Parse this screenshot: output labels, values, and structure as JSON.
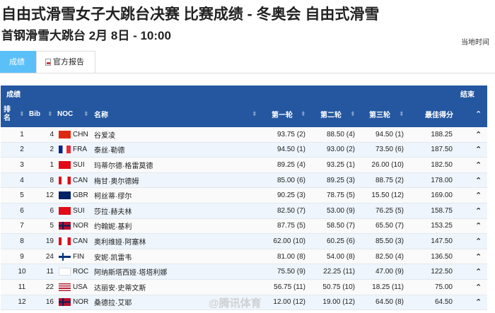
{
  "header": {
    "title": "自由式滑雪女子大跳台决赛 比赛成绩 - 冬奥会 自由式滑雪",
    "subtitle": "首钢滑雪大跳台 2月 8日 - 10:00",
    "local_time": "当地时间"
  },
  "tabs": [
    {
      "label": "成绩"
    },
    {
      "label": "官方报告"
    }
  ],
  "table": {
    "section": "成绩",
    "status": "结束",
    "columns": {
      "rank": "排名",
      "bib": "Bib",
      "noc": "NOC",
      "name": "名称",
      "r1": "第一轮",
      "r2": "第二轮",
      "r3": "第三轮",
      "best": "最佳得分"
    },
    "rows": [
      {
        "rank": "1",
        "bib": "4",
        "noc": "CHN",
        "name": "谷爱凌",
        "r1": "93.75 (2)",
        "r2": "88.50 (4)",
        "r3": "94.50 (1)",
        "best": "188.25"
      },
      {
        "rank": "2",
        "bib": "2",
        "noc": "FRA",
        "name": "泰丝·勒德",
        "r1": "94.50 (1)",
        "r2": "93.00 (2)",
        "r3": "73.50 (6)",
        "best": "187.50"
      },
      {
        "rank": "3",
        "bib": "1",
        "noc": "SUI",
        "name": "玛蒂尔德·格雷莫德",
        "r1": "89.25 (4)",
        "r2": "93.25 (1)",
        "r3": "26.00 (10)",
        "best": "182.50"
      },
      {
        "rank": "4",
        "bib": "8",
        "noc": "CAN",
        "name": "梅甘·奥尔德姆",
        "r1": "85.00 (6)",
        "r2": "89.25 (3)",
        "r3": "88.75 (2)",
        "best": "178.00"
      },
      {
        "rank": "5",
        "bib": "12",
        "noc": "GBR",
        "name": "柯丝蒂·缪尔",
        "r1": "90.25 (3)",
        "r2": "78.75 (5)",
        "r3": "15.50 (12)",
        "best": "169.00"
      },
      {
        "rank": "6",
        "bib": "6",
        "noc": "SUI",
        "name": "莎拉·赫夫林",
        "r1": "82.50 (7)",
        "r2": "53.00 (9)",
        "r3": "76.25 (5)",
        "best": "158.75"
      },
      {
        "rank": "7",
        "bib": "5",
        "noc": "NOR",
        "name": "约翰妮·基利",
        "r1": "87.75 (5)",
        "r2": "58.50 (7)",
        "r3": "65.50 (7)",
        "best": "153.25"
      },
      {
        "rank": "8",
        "bib": "19",
        "noc": "CAN",
        "name": "奥利维娅·阿塞林",
        "r1": "62.00 (10)",
        "r2": "60.25 (6)",
        "r3": "85.50 (3)",
        "best": "147.50"
      },
      {
        "rank": "9",
        "bib": "24",
        "noc": "FIN",
        "name": "安妮·凯雷韦",
        "r1": "81.00 (8)",
        "r2": "54.00 (8)",
        "r3": "82.50 (4)",
        "best": "136.50"
      },
      {
        "rank": "10",
        "bib": "11",
        "noc": "ROC",
        "name": "阿纳斯塔西娅·塔塔利娜",
        "r1": "75.50 (9)",
        "r2": "22.25 (11)",
        "r3": "47.00 (9)",
        "best": "122.50"
      },
      {
        "rank": "11",
        "bib": "22",
        "noc": "USA",
        "name": "达丽安·史蒂文斯",
        "r1": "56.75 (11)",
        "r2": "50.75 (10)",
        "r3": "18.25 (11)",
        "best": "75.00"
      },
      {
        "rank": "12",
        "bib": "16",
        "noc": "NOR",
        "name": "桑德拉·艾耶",
        "r1": "12.00 (12)",
        "r2": "19.00 (12)",
        "r3": "64.50 (8)",
        "best": "64.50"
      }
    ]
  },
  "watermark": "@腾讯体育",
  "colors": {
    "header": "#2457a0",
    "tab_active": "#5bc0f8"
  }
}
